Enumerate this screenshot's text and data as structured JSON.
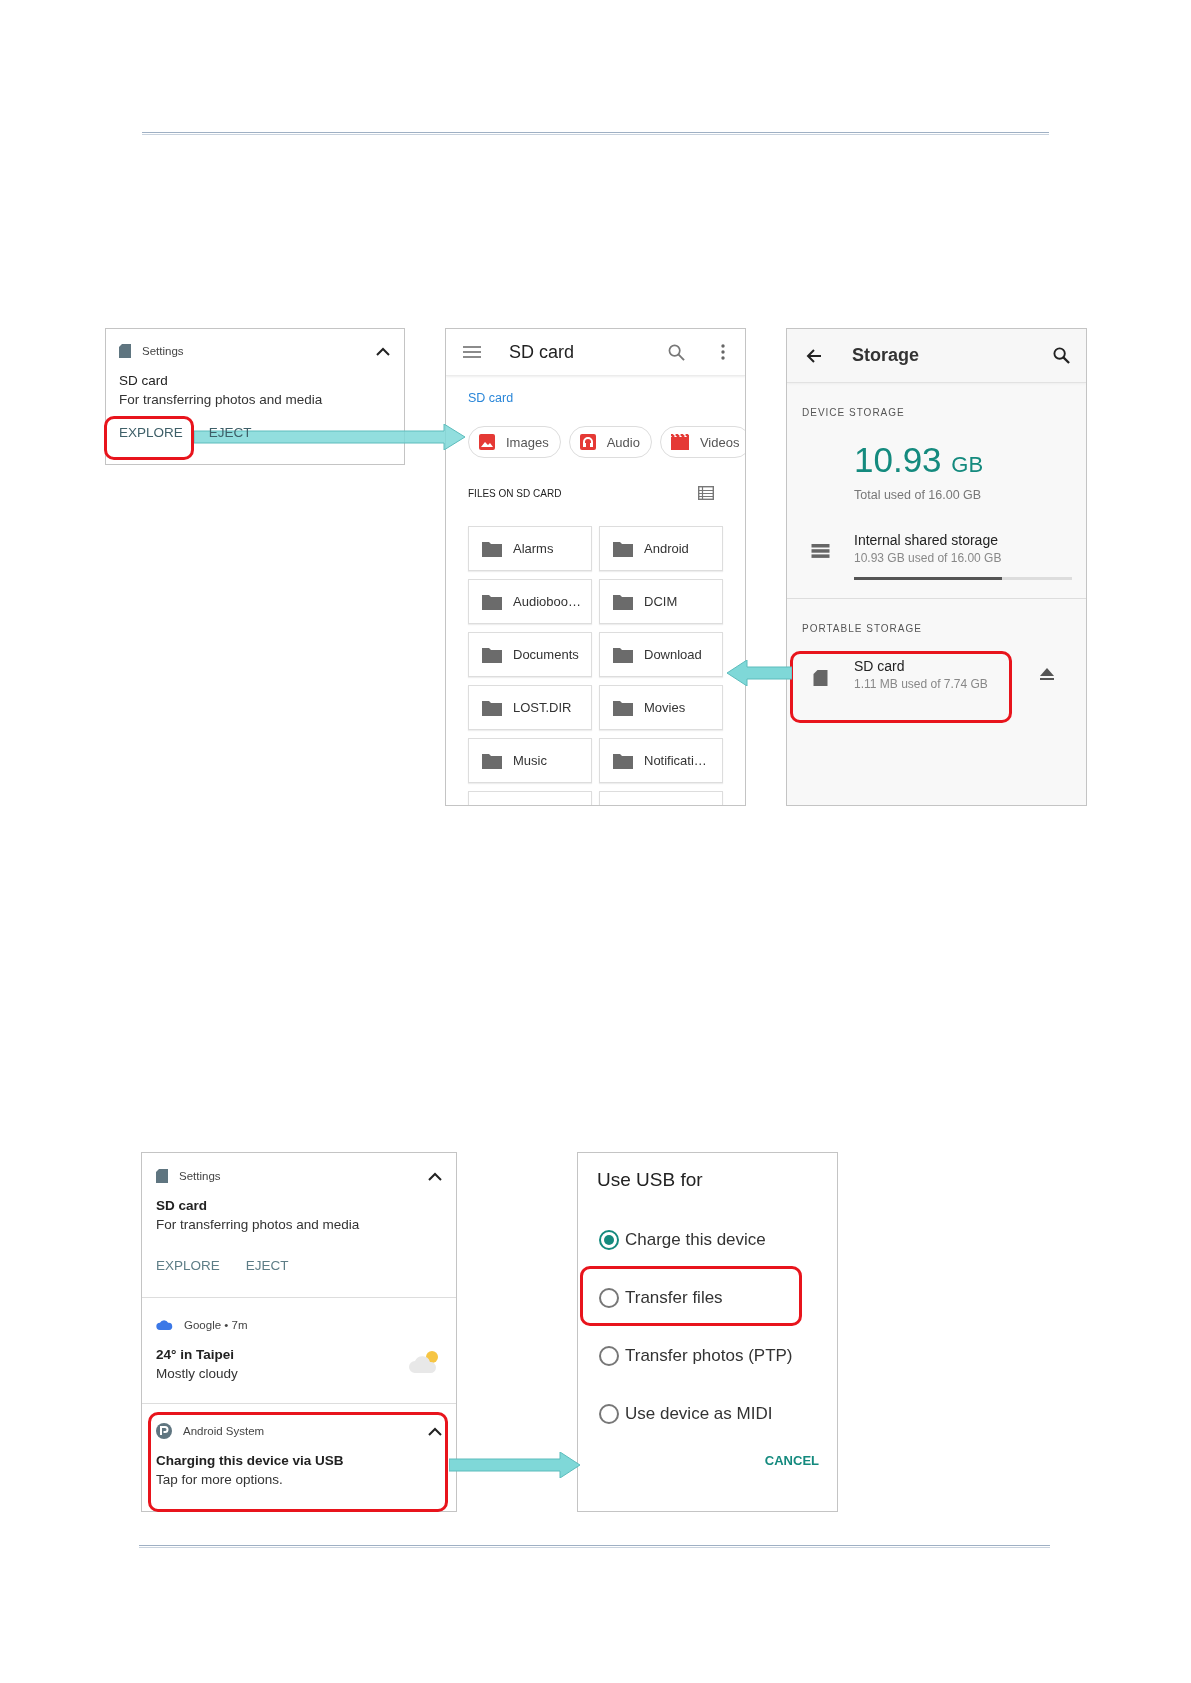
{
  "figure_1": {
    "notification": {
      "app": "Settings",
      "title": "SD card",
      "text": "For transferring photos and media",
      "actions": [
        "EXPLORE",
        "EJECT"
      ]
    },
    "files": {
      "title": "SD card",
      "breadcrumb": "SD card",
      "chips": [
        {
          "label": "Images",
          "kind": "images"
        },
        {
          "label": "Audio",
          "kind": "audio"
        },
        {
          "label": "Videos",
          "kind": "videos"
        }
      ],
      "section": "FILES ON SD CARD",
      "folders": [
        "Alarms",
        "Android",
        "Audioboo…",
        "DCIM",
        "Documents",
        "Download",
        "LOST.DIR",
        "Movies",
        "Music",
        "Notificati…"
      ]
    },
    "storage": {
      "title": "Storage",
      "device_header": "DEVICE STORAGE",
      "used_value": "10.93",
      "used_unit": "GB",
      "used_caption": "Total used of 16.00 GB",
      "internal": {
        "title": "Internal shared storage",
        "detail": "10.93 GB used of 16.00 GB",
        "level": 0.68
      },
      "portable_header": "PORTABLE STORAGE",
      "sd": {
        "title": "SD card",
        "detail": "1.11 MB used of 7.74 GB"
      }
    }
  },
  "figure_2": {
    "notifications": [
      {
        "kind": "sd",
        "app": "Settings",
        "title": "SD card",
        "text": "For transferring photos and media",
        "actions": [
          "EXPLORE",
          "EJECT"
        ]
      },
      {
        "kind": "weather",
        "app": "Google • 7m",
        "title": "24° in Taipei",
        "text": "Mostly cloudy"
      },
      {
        "kind": "system",
        "app": "Android System",
        "title": "Charging this device via USB",
        "text": "Tap for more options."
      }
    ],
    "usb_dialog": {
      "title": "Use USB for",
      "options": [
        {
          "label": "Charge this device",
          "selected": true
        },
        {
          "label": "Transfer files",
          "selected": false
        },
        {
          "label": "Transfer photos (PTP)",
          "selected": false
        },
        {
          "label": "Use device as MIDI",
          "selected": false
        }
      ],
      "cancel": "CANCEL"
    }
  }
}
